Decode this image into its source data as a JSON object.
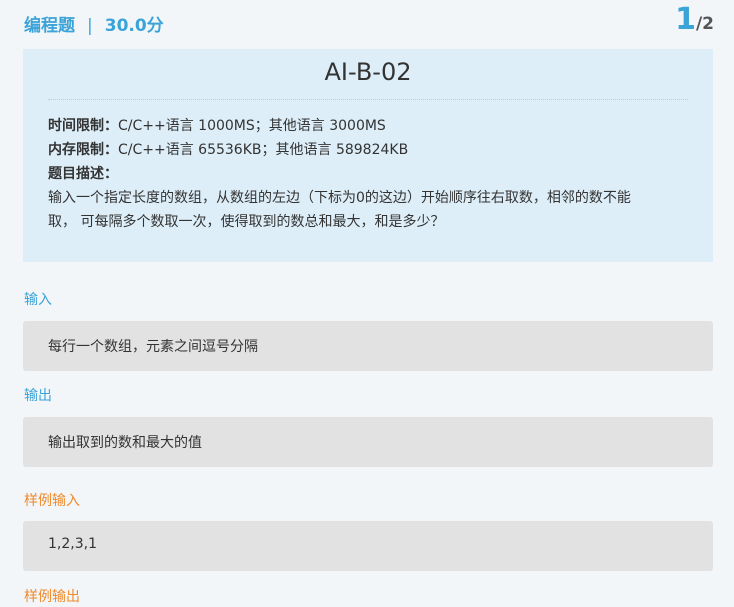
{
  "header": {
    "type_label": "编程题",
    "separator": "|",
    "score": "30.0分",
    "page_current": "1",
    "page_total": "/2"
  },
  "problem": {
    "title": "AI-B-02",
    "time_limit_label": "时间限制：",
    "time_limit_value": "C/C++语言 1000MS；其他语言 3000MS",
    "memory_limit_label": "内存限制：",
    "memory_limit_value": "C/C++语言 65536KB；其他语言 589824KB",
    "description_label": "题目描述：",
    "description_line1": "输入一个指定长度的数组，从数组的左边（下标为0的这边）开始顺序往右取数，相邻的数不能",
    "description_line2": "取， 可每隔多个数取一次，使得取到的数总和最大，和是多少？"
  },
  "input": {
    "label": "输入",
    "content": "每行一个数组，元素之间逗号分隔"
  },
  "output": {
    "label": "输出",
    "content": "输出取到的数和最大的值"
  },
  "sample_input": {
    "label": "样例输入",
    "content": "1,2,3,1"
  },
  "sample_output": {
    "label": "样例输出"
  },
  "colors": {
    "accent_blue": "#3aa3d8",
    "accent_orange": "#f08a2a",
    "info_bg": "#ddeef8",
    "box_bg": "#e2e2e2",
    "page_bg": "#f3f6f9"
  }
}
